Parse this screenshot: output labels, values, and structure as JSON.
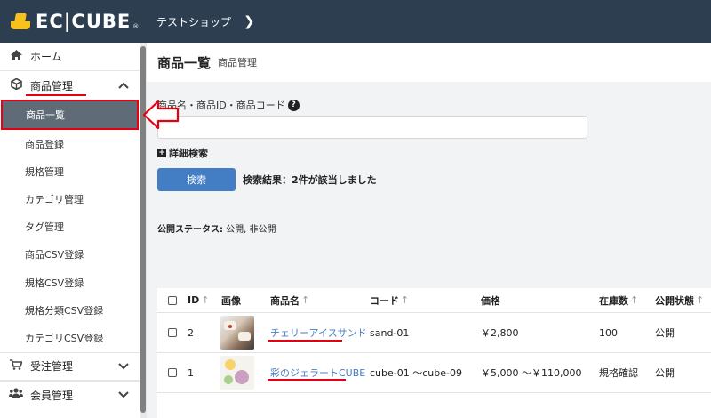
{
  "header": {
    "logo_text": "EC|CUBE",
    "logo_reg": "®",
    "shop_name": "テストショップ",
    "shop_chevron": "❯"
  },
  "sidebar": {
    "items": [
      {
        "label": "ホーム",
        "icon": "home-icon"
      },
      {
        "label": "商品管理",
        "icon": "cube-icon",
        "expanded": true
      }
    ],
    "sub_items": [
      {
        "label": "商品一覧",
        "active": true
      },
      {
        "label": "商品登録"
      },
      {
        "label": "規格管理"
      },
      {
        "label": "カテゴリ管理"
      },
      {
        "label": "タグ管理"
      },
      {
        "label": "商品CSV登録"
      },
      {
        "label": "規格CSV登録"
      },
      {
        "label": "規格分類CSV登録"
      },
      {
        "label": "カテゴリCSV登録"
      }
    ],
    "bottom_items": [
      {
        "label": "受注管理",
        "icon": "cart-icon"
      },
      {
        "label": "会員管理",
        "icon": "users-icon"
      }
    ]
  },
  "main": {
    "title": "商品一覧",
    "subtitle": "商品管理",
    "search_label": "商品名・商品ID・商品コード",
    "help_icon": "?",
    "search_value": "",
    "detail_search": "詳細検索",
    "detail_plus": "+",
    "search_button": "検索",
    "result_text": "検索結果：2件が該当しました",
    "status_label": "公開ステータス:",
    "status_value": " 公開, 非公開"
  },
  "table": {
    "columns": [
      "ID",
      "画像",
      "商品名",
      "コード",
      "価格",
      "在庫数",
      "公開状態"
    ],
    "sort_glyph": "↑",
    "rows": [
      {
        "id": "2",
        "name": "チェリーアイスサンド",
        "code": "sand-01",
        "price": "￥2,800",
        "stock": "100",
        "status": "公開"
      },
      {
        "id": "1",
        "name": "彩のジェラートCUBE",
        "code": "cube-01 〜cube-09",
        "price": "￥5,000 〜￥110,000",
        "stock": "規格確認",
        "status": "公開"
      }
    ]
  },
  "colors": {
    "header_bg": "#2c3e50",
    "active_item_bg": "#5f6c77",
    "accent_blue": "#437ec4",
    "annotation_red": "#e60012",
    "logo_yellow": "#f7c21b"
  }
}
